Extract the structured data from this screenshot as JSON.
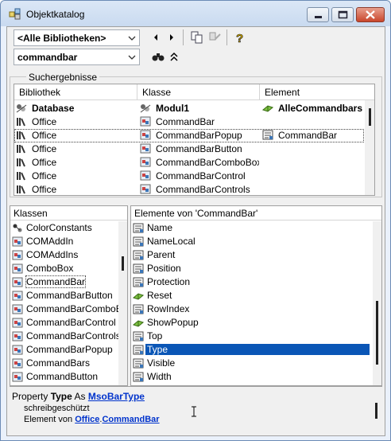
{
  "window": {
    "title": "Objektkatalog"
  },
  "toolbar": {
    "library": "<Alle Bibliotheken>",
    "search": "commandbar"
  },
  "results": {
    "group_label": "Suchergebnisse",
    "columns": [
      "Bibliothek",
      "Klasse",
      "Element"
    ],
    "rows": [
      {
        "library": "Database",
        "class": "Modul1",
        "element": "AlleCommandbars",
        "bold": true
      },
      {
        "library": "Office",
        "class": "CommandBar",
        "element": ""
      },
      {
        "library": "Office",
        "class": "CommandBarPopup",
        "element": "CommandBar"
      },
      {
        "library": "Office",
        "class": "CommandBarButton",
        "element": ""
      },
      {
        "library": "Office",
        "class": "CommandBarComboBox",
        "element": ""
      },
      {
        "library": "Office",
        "class": "CommandBarControl",
        "element": ""
      },
      {
        "library": "Office",
        "class": "CommandBarControls",
        "element": ""
      }
    ]
  },
  "classes": {
    "header": "Klassen",
    "items": [
      "ColorConstants",
      "COMAddIn",
      "COMAddIns",
      "ComboBox",
      "CommandBar",
      "CommandBarButton",
      "CommandBarComboBox",
      "CommandBarControl",
      "CommandBarControls",
      "CommandBarPopup",
      "CommandBars",
      "CommandButton"
    ]
  },
  "members": {
    "header": "Elemente von 'CommandBar'",
    "items": [
      "Name",
      "NameLocal",
      "Parent",
      "Position",
      "Protection",
      "Reset",
      "RowIndex",
      "ShowPopup",
      "Top",
      "Type",
      "Visible",
      "Width"
    ],
    "selected": "Type"
  },
  "detail": {
    "line1_prefix": "Property ",
    "line1_name": "Type",
    "line1_as": " As ",
    "line1_type": "MsoBarType",
    "line2": "schreibgeschützt",
    "line3_prefix": "Element von ",
    "line3_lib": "Office",
    "line3_dot": ".",
    "line3_class": "CommandBar"
  },
  "colors": {
    "selection": "#0a56b6",
    "link": "#0033cc"
  }
}
